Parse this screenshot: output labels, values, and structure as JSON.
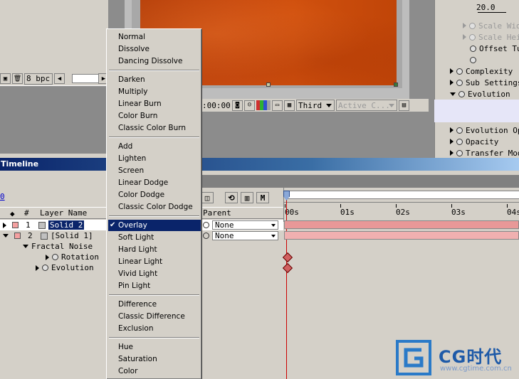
{
  "project_panel": {
    "depth_label": "8 bpc"
  },
  "composition": {
    "timecode": ":00:00",
    "view_layout": "Third",
    "active_camera": "Active C..."
  },
  "effect_controls": {
    "top_value": "20.0",
    "properties": [
      {
        "label": "Scale Wid",
        "dim": true
      },
      {
        "label": "Scale Hei",
        "dim": true
      },
      {
        "label": "Offset Tu",
        "dim": false
      },
      {
        "label": "",
        "dim": false
      },
      {
        "label": "Complexity",
        "dim": false
      },
      {
        "label": "Sub Settings",
        "dim": false
      },
      {
        "label": "Evolution",
        "dim": false
      },
      {
        "label": "Evolution Opti",
        "dim": false
      },
      {
        "label": "Opacity",
        "dim": false
      },
      {
        "label": "Transfer Mod",
        "dim": false
      }
    ]
  },
  "timeline": {
    "title": "Timeline",
    "current_time": "0",
    "columns": {
      "number": "#",
      "layer_name": "Layer Name",
      "parent": "Parent"
    },
    "control_buttons": {
      "motion_blur": "M"
    },
    "ruler_ticks": [
      "00s",
      "01s",
      "02s",
      "03s",
      "04s"
    ],
    "layers": [
      {
        "number": "1",
        "name": "Solid 2",
        "selected": true,
        "parent": "None"
      },
      {
        "number": "2",
        "name": "[Solid 1]",
        "selected": false,
        "parent": "None"
      }
    ],
    "effect_group": "Fractal Noise",
    "properties": [
      {
        "label": "Rotation"
      },
      {
        "label": "Evolution"
      }
    ]
  },
  "blend_menu": {
    "groups": [
      [
        "Normal",
        "Dissolve",
        "Dancing Dissolve"
      ],
      [
        "Darken",
        "Multiply",
        "Linear Burn",
        "Color Burn",
        "Classic Color Burn"
      ],
      [
        "Add",
        "Lighten",
        "Screen",
        "Linear Dodge",
        "Color Dodge",
        "Classic Color Dodge"
      ],
      [
        "Overlay",
        "Soft Light",
        "Hard Light",
        "Linear Light",
        "Vivid Light",
        "Pin Light"
      ],
      [
        "Difference",
        "Classic Difference",
        "Exclusion"
      ],
      [
        "Hue",
        "Saturation",
        "Color"
      ]
    ],
    "selected": "Overlay",
    "check_glyph": "✔"
  },
  "watermark": {
    "brand": "CG时代",
    "url": "www.cgtime.com.cn"
  },
  "colors": {
    "selection": "#0a246a",
    "title_bar": "#0a246a",
    "solid_orange": "#c84b10",
    "layer_label": "#f4a0a0",
    "playhead": "#cc0000"
  }
}
